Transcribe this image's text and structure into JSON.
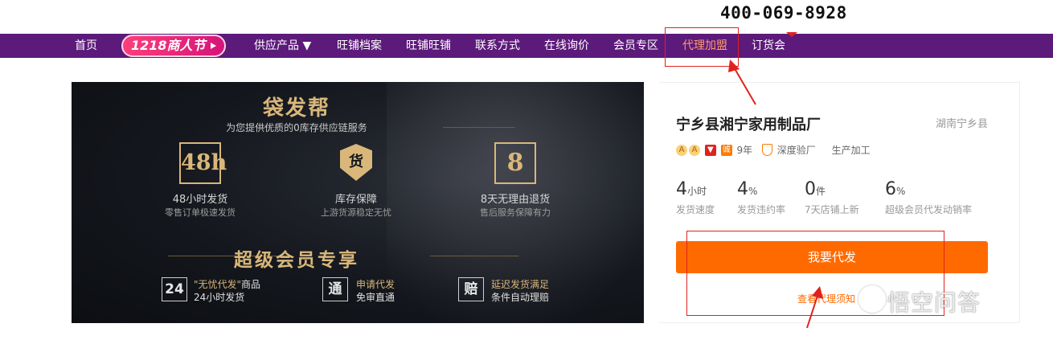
{
  "header": {
    "phone": "400-069-8928"
  },
  "nav": {
    "home": "首页",
    "promo": "1218商人节",
    "items": [
      "供应产品 ▼",
      "旺铺档案",
      "旺铺旺铺",
      "联系方式",
      "在线询价",
      "会员专区",
      "代理加盟",
      "订货会"
    ],
    "active_index": 6
  },
  "banner": {
    "title": "袋发帮",
    "subtitle": "为您提供优质的0库存供应链服务",
    "features": [
      {
        "icon_text": "48h",
        "icon": "48h-clock-icon",
        "title": "48小时发货",
        "desc": "零售订单极速发货"
      },
      {
        "icon_text": "货",
        "icon": "inventory-shield-icon",
        "title": "库存保障",
        "desc": "上游货源稳定无忧"
      },
      {
        "icon_text": "8",
        "icon": "8-day-return-icon",
        "title": "8天无理由退货",
        "desc": "售后服务保障有力"
      }
    ],
    "vip_title": "超级会员专享",
    "vip_items": [
      {
        "icon_text": "24",
        "line1_hl": "\"无忧代发\"",
        "line1": "商品",
        "line2": "24小时发货"
      },
      {
        "icon_text": "通",
        "line1_hl": "申请代发",
        "line1": "",
        "line2": "免审直通"
      },
      {
        "icon_text": "赔",
        "line1_hl": "延迟发货满足",
        "line1": "",
        "line2": "条件自动理赔"
      }
    ]
  },
  "store": {
    "name": "宁乡县湘宁家用制品厂",
    "location": "湖南宁乡县",
    "tags": {
      "years": "9年",
      "verified": "深度验厂",
      "type": "生产加工"
    },
    "stats": [
      {
        "value": "4",
        "unit": "小时",
        "label": "发货速度"
      },
      {
        "value": "4",
        "unit": "%",
        "label": "发货违约率"
      },
      {
        "value": "0",
        "unit": "件",
        "label": "7天店铺上新"
      },
      {
        "value": "6",
        "unit": "%",
        "label": "超级会员代发动销率"
      }
    ],
    "primary_button": "我要代发",
    "secondary_link": "查看代理须知"
  },
  "watermark": {
    "text": "悟空问答"
  },
  "colors": {
    "nav_bg": "#5c1a7a",
    "accent": "#ff6a00",
    "annotation": "#e0221e",
    "gold": "#d9b77a"
  }
}
